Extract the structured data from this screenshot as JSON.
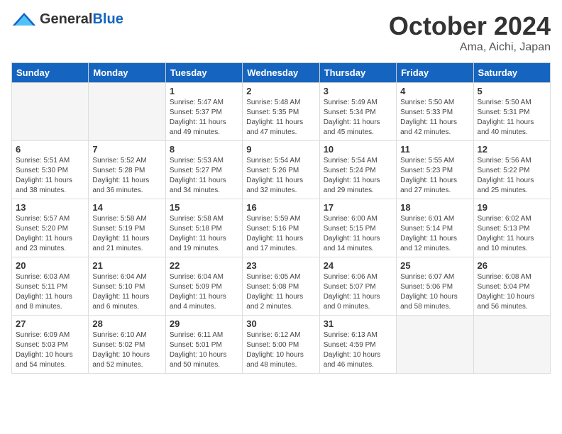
{
  "header": {
    "logo_general": "General",
    "logo_blue": "Blue",
    "month_title": "October 2024",
    "location": "Ama, Aichi, Japan"
  },
  "days_of_week": [
    "Sunday",
    "Monday",
    "Tuesday",
    "Wednesday",
    "Thursday",
    "Friday",
    "Saturday"
  ],
  "weeks": [
    [
      {
        "day": "",
        "content": ""
      },
      {
        "day": "",
        "content": ""
      },
      {
        "day": "1",
        "content": "Sunrise: 5:47 AM\nSunset: 5:37 PM\nDaylight: 11 hours and 49 minutes."
      },
      {
        "day": "2",
        "content": "Sunrise: 5:48 AM\nSunset: 5:35 PM\nDaylight: 11 hours and 47 minutes."
      },
      {
        "day": "3",
        "content": "Sunrise: 5:49 AM\nSunset: 5:34 PM\nDaylight: 11 hours and 45 minutes."
      },
      {
        "day": "4",
        "content": "Sunrise: 5:50 AM\nSunset: 5:33 PM\nDaylight: 11 hours and 42 minutes."
      },
      {
        "day": "5",
        "content": "Sunrise: 5:50 AM\nSunset: 5:31 PM\nDaylight: 11 hours and 40 minutes."
      }
    ],
    [
      {
        "day": "6",
        "content": "Sunrise: 5:51 AM\nSunset: 5:30 PM\nDaylight: 11 hours and 38 minutes."
      },
      {
        "day": "7",
        "content": "Sunrise: 5:52 AM\nSunset: 5:28 PM\nDaylight: 11 hours and 36 minutes."
      },
      {
        "day": "8",
        "content": "Sunrise: 5:53 AM\nSunset: 5:27 PM\nDaylight: 11 hours and 34 minutes."
      },
      {
        "day": "9",
        "content": "Sunrise: 5:54 AM\nSunset: 5:26 PM\nDaylight: 11 hours and 32 minutes."
      },
      {
        "day": "10",
        "content": "Sunrise: 5:54 AM\nSunset: 5:24 PM\nDaylight: 11 hours and 29 minutes."
      },
      {
        "day": "11",
        "content": "Sunrise: 5:55 AM\nSunset: 5:23 PM\nDaylight: 11 hours and 27 minutes."
      },
      {
        "day": "12",
        "content": "Sunrise: 5:56 AM\nSunset: 5:22 PM\nDaylight: 11 hours and 25 minutes."
      }
    ],
    [
      {
        "day": "13",
        "content": "Sunrise: 5:57 AM\nSunset: 5:20 PM\nDaylight: 11 hours and 23 minutes."
      },
      {
        "day": "14",
        "content": "Sunrise: 5:58 AM\nSunset: 5:19 PM\nDaylight: 11 hours and 21 minutes."
      },
      {
        "day": "15",
        "content": "Sunrise: 5:58 AM\nSunset: 5:18 PM\nDaylight: 11 hours and 19 minutes."
      },
      {
        "day": "16",
        "content": "Sunrise: 5:59 AM\nSunset: 5:16 PM\nDaylight: 11 hours and 17 minutes."
      },
      {
        "day": "17",
        "content": "Sunrise: 6:00 AM\nSunset: 5:15 PM\nDaylight: 11 hours and 14 minutes."
      },
      {
        "day": "18",
        "content": "Sunrise: 6:01 AM\nSunset: 5:14 PM\nDaylight: 11 hours and 12 minutes."
      },
      {
        "day": "19",
        "content": "Sunrise: 6:02 AM\nSunset: 5:13 PM\nDaylight: 11 hours and 10 minutes."
      }
    ],
    [
      {
        "day": "20",
        "content": "Sunrise: 6:03 AM\nSunset: 5:11 PM\nDaylight: 11 hours and 8 minutes."
      },
      {
        "day": "21",
        "content": "Sunrise: 6:04 AM\nSunset: 5:10 PM\nDaylight: 11 hours and 6 minutes."
      },
      {
        "day": "22",
        "content": "Sunrise: 6:04 AM\nSunset: 5:09 PM\nDaylight: 11 hours and 4 minutes."
      },
      {
        "day": "23",
        "content": "Sunrise: 6:05 AM\nSunset: 5:08 PM\nDaylight: 11 hours and 2 minutes."
      },
      {
        "day": "24",
        "content": "Sunrise: 6:06 AM\nSunset: 5:07 PM\nDaylight: 11 hours and 0 minutes."
      },
      {
        "day": "25",
        "content": "Sunrise: 6:07 AM\nSunset: 5:06 PM\nDaylight: 10 hours and 58 minutes."
      },
      {
        "day": "26",
        "content": "Sunrise: 6:08 AM\nSunset: 5:04 PM\nDaylight: 10 hours and 56 minutes."
      }
    ],
    [
      {
        "day": "27",
        "content": "Sunrise: 6:09 AM\nSunset: 5:03 PM\nDaylight: 10 hours and 54 minutes."
      },
      {
        "day": "28",
        "content": "Sunrise: 6:10 AM\nSunset: 5:02 PM\nDaylight: 10 hours and 52 minutes."
      },
      {
        "day": "29",
        "content": "Sunrise: 6:11 AM\nSunset: 5:01 PM\nDaylight: 10 hours and 50 minutes."
      },
      {
        "day": "30",
        "content": "Sunrise: 6:12 AM\nSunset: 5:00 PM\nDaylight: 10 hours and 48 minutes."
      },
      {
        "day": "31",
        "content": "Sunrise: 6:13 AM\nSunset: 4:59 PM\nDaylight: 10 hours and 46 minutes."
      },
      {
        "day": "",
        "content": ""
      },
      {
        "day": "",
        "content": ""
      }
    ]
  ]
}
